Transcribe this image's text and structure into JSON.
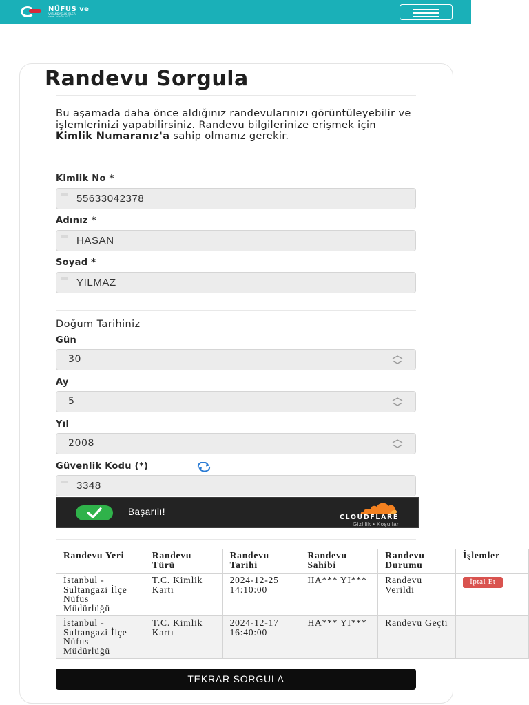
{
  "header": {
    "logo_line1": "NÜFUS ve",
    "logo_line2": "VATANDAŞLIK İŞLERİ",
    "logo_line3": "GENEL MÜDÜRLÜĞÜ",
    "menu_icon": "hamburger-icon"
  },
  "page": {
    "title": "Randevu Sorgula",
    "intro_part1": "Bu aşamada daha önce aldığınız randevularınızı görüntüleyebilir ve işlemlerinizi yapabilirsiniz. Randevu bilgilerinize erişmek için ",
    "intro_bold": "Kimlik Numaranız'a",
    "intro_part2": " sahip olmanız gerekir."
  },
  "form": {
    "tc_label": "Kimlik No *",
    "tc_value": "55633042378",
    "name_label": "Adınız *",
    "name_value": "HASAN",
    "surname_label": "Soyad *",
    "surname_value": "YILMAZ",
    "birth_heading": "Doğum Tarihiniz",
    "day_label": "Gün",
    "day_value": "30",
    "month_label": "Ay",
    "month_value": "5",
    "year_label": "Yıl",
    "year_value": "2008",
    "captcha_label": "Güvenlik Kodu (*)",
    "captcha_value": "3348",
    "refresh_icon": "refresh-icon"
  },
  "cloudflare": {
    "status": "Başarılı!",
    "brand": "CLOUDFLARE",
    "privacy": "Gizlilik",
    "separator": "•",
    "terms": "Koşullar"
  },
  "table": {
    "headers": [
      "Randevu Yeri",
      "Randevu Türü",
      "Randevu Tarihi",
      "Randevu Sahibi",
      "Randevu Durumu",
      "İşlemler"
    ],
    "rows": [
      {
        "place": "İstanbul - Sultangazi İlçe Nüfus Müdürlüğü",
        "type": "T.C. Kimlik Kartı",
        "date": "2024-12-25 14:10:00",
        "owner": "HA*** YI***",
        "status": "Randevu Verildi",
        "action": "İptal Et"
      },
      {
        "place": "İstanbul - Sultangazi İlçe Nüfus Müdürlüğü",
        "type": "T.C. Kimlik Kartı",
        "date": "2024-12-17 16:40:00",
        "owner": "HA*** YI***",
        "status": "Randevu Geçti",
        "action": ""
      }
    ]
  },
  "actions": {
    "requery_label": "TEKRAR SORGULA"
  },
  "colors": {
    "header_bg": "#1ab0b8",
    "cancel_bg": "#d9534f",
    "cf_success": "#2fb24a",
    "cf_orange": "#f48120"
  }
}
